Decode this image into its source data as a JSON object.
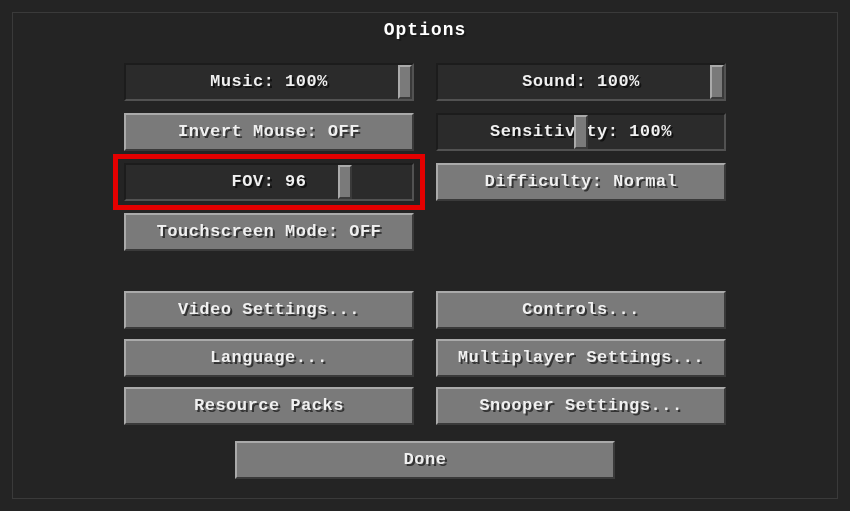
{
  "title": "Options",
  "sliders": {
    "music": {
      "label": "Music: 100%",
      "percent": 100
    },
    "sound": {
      "label": "Sound: 100%",
      "percent": 100
    },
    "sensitivity": {
      "label": "Sensitivity: 100%",
      "percent": 50
    },
    "fov": {
      "label": "FOV: 96",
      "percent": 78
    }
  },
  "toggles": {
    "invert_mouse": "Invert Mouse: OFF",
    "difficulty": "Difficulty: Normal",
    "touchscreen": "Touchscreen Mode: OFF"
  },
  "buttons": {
    "video": "Video Settings...",
    "controls": "Controls...",
    "language": "Language...",
    "multiplayer": "Multiplayer Settings...",
    "resource": "Resource Packs",
    "snooper": "Snooper Settings...",
    "done": "Done"
  },
  "highlight": "fov"
}
